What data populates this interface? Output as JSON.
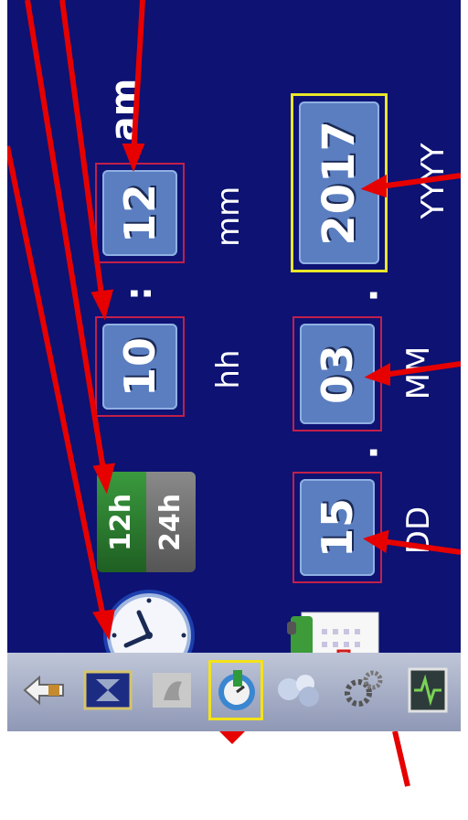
{
  "time": {
    "hour": "10",
    "minute": "12",
    "ampm": "am",
    "hour_label": "hh",
    "minute_label": "mm",
    "separator": ":"
  },
  "format_toggle": {
    "option_12": "12h",
    "option_24": "24h",
    "selected": "12h"
  },
  "date": {
    "day": "15",
    "month": "03",
    "year": "2017",
    "day_label": "DD",
    "month_label": "MM",
    "year_label": "YYYY",
    "separator": "."
  },
  "icons": {
    "clock": "clock-icon",
    "calendar": "calendar-icon"
  },
  "taskbar": {
    "items": [
      {
        "name": "back-icon"
      },
      {
        "name": "hourglass-icon"
      },
      {
        "name": "ghost-app-icon"
      },
      {
        "name": "datetime-settings-icon",
        "active": true
      },
      {
        "name": "network-icon"
      },
      {
        "name": "gears-icon"
      },
      {
        "name": "heartbeat-monitor-icon"
      }
    ]
  },
  "colors": {
    "background": "#0d1273",
    "tile": "#5a7ec0",
    "tile_border": "#c2204a",
    "selection": "#e8e52a",
    "toggle_on": "#2e7d32",
    "toggle_off": "#6f6f6f",
    "arrow": "#e60000"
  }
}
